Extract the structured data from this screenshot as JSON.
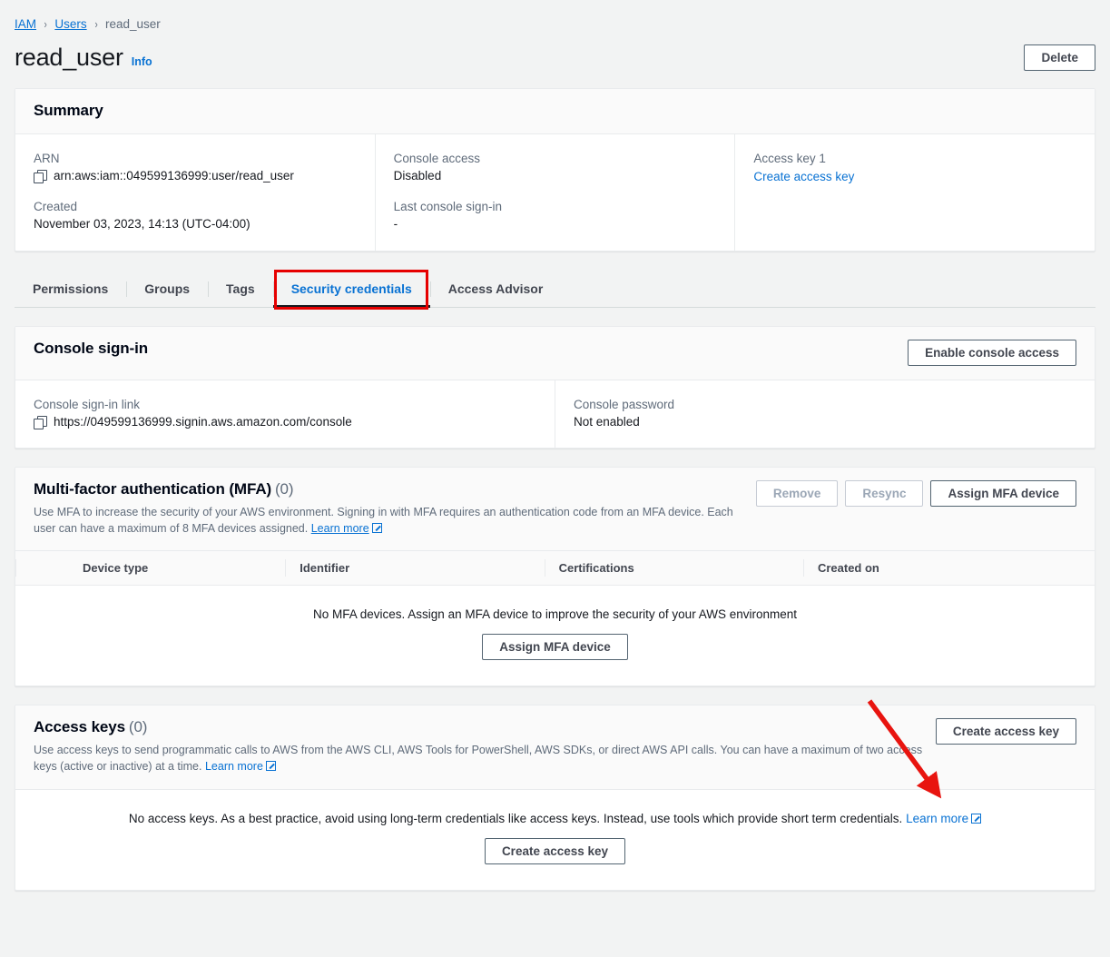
{
  "breadcrumb": {
    "items": [
      {
        "label": "IAM",
        "link": true
      },
      {
        "label": "Users",
        "link": true
      },
      {
        "label": "read_user",
        "link": false
      }
    ],
    "separator": "›"
  },
  "header": {
    "title": "read_user",
    "info_label": "Info",
    "delete_label": "Delete"
  },
  "summary": {
    "title": "Summary",
    "arn_label": "ARN",
    "arn_value": "arn:aws:iam::049599136999:user/read_user",
    "created_label": "Created",
    "created_value": "November 03, 2023, 14:13 (UTC-04:00)",
    "console_access_label": "Console access",
    "console_access_value": "Disabled",
    "last_signin_label": "Last console sign-in",
    "last_signin_value": "-",
    "access_key_label": "Access key 1",
    "access_key_link": "Create access key"
  },
  "tabs": [
    {
      "label": "Permissions",
      "active": false
    },
    {
      "label": "Groups",
      "active": false
    },
    {
      "label": "Tags",
      "active": false
    },
    {
      "label": "Security credentials",
      "active": true
    },
    {
      "label": "Access Advisor",
      "active": false
    }
  ],
  "console_signin": {
    "title": "Console sign-in",
    "enable_button": "Enable console access",
    "link_label": "Console sign-in link",
    "link_value": "https://049599136999.signin.aws.amazon.com/console",
    "password_label": "Console password",
    "password_value": "Not enabled"
  },
  "mfa": {
    "title": "Multi-factor authentication (MFA)",
    "count": "(0)",
    "description": "Use MFA to increase the security of your AWS environment. Signing in with MFA requires an authentication code from an MFA device. Each user can have a maximum of 8 MFA devices assigned.",
    "learn_more": "Learn more",
    "remove_button": "Remove",
    "resync_button": "Resync",
    "assign_button": "Assign MFA device",
    "columns": [
      "Device type",
      "Identifier",
      "Certifications",
      "Created on"
    ],
    "empty_text": "No MFA devices. Assign an MFA device to improve the security of your AWS environment",
    "empty_button": "Assign MFA device"
  },
  "access_keys": {
    "title": "Access keys",
    "count": "(0)",
    "description": "Use access keys to send programmatic calls to AWS from the AWS CLI, AWS Tools for PowerShell, AWS SDKs, or direct AWS API calls. You can have a maximum of two access keys (active or inactive) at a time.",
    "learn_more": "Learn more",
    "create_button": "Create access key",
    "empty_text": "No access keys. As a best practice, avoid using long-term credentials like access keys. Instead, use tools which provide short term credentials.",
    "empty_learn_more": "Learn more",
    "empty_button": "Create access key"
  },
  "annotations": {
    "highlight_color": "#e60000",
    "arrow_color": "#e8140f",
    "arrow_target": "create-access-key-button"
  }
}
